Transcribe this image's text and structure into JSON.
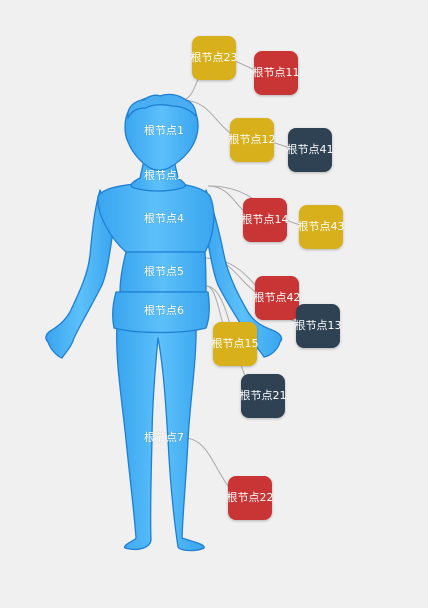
{
  "colors": {
    "background": "#f0f0f0",
    "body_fill": "#4bb3f5",
    "body_stroke": "#1f7fd3",
    "link": "#aaaaaa",
    "yellow": "#d8b01a",
    "red": "#c93434",
    "dark": "#2e4352"
  },
  "body_regions": [
    {
      "id": "1",
      "label": "根节点1"
    },
    {
      "id": "2",
      "label": "根节点2"
    },
    {
      "id": "4",
      "label": "根节点4"
    },
    {
      "id": "5",
      "label": "根节点5"
    },
    {
      "id": "6",
      "label": "根节点6"
    },
    {
      "id": "7",
      "label": "根节点7"
    }
  ],
  "nodes": [
    {
      "id": "23",
      "label": "根节点23",
      "color": "yellow",
      "parent": "1"
    },
    {
      "id": "11",
      "label": "根节点11",
      "color": "red",
      "parent": "23"
    },
    {
      "id": "12",
      "label": "根节点12",
      "color": "yellow",
      "parent": "1"
    },
    {
      "id": "41",
      "label": "根节点41",
      "color": "dark",
      "parent": "12"
    },
    {
      "id": "14",
      "label": "根节点14",
      "color": "red",
      "parent": "4"
    },
    {
      "id": "43",
      "label": "根节点43",
      "color": "yellow",
      "parent": "4"
    },
    {
      "id": "42",
      "label": "根节点42",
      "color": "red",
      "parent": "5"
    },
    {
      "id": "13",
      "label": "根节点13",
      "color": "dark",
      "parent": "5"
    },
    {
      "id": "15",
      "label": "根节点15",
      "color": "yellow",
      "parent": "6"
    },
    {
      "id": "21",
      "label": "根节点21",
      "color": "dark",
      "parent": "6"
    },
    {
      "id": "22",
      "label": "根节点22",
      "color": "red",
      "parent": "7"
    }
  ]
}
